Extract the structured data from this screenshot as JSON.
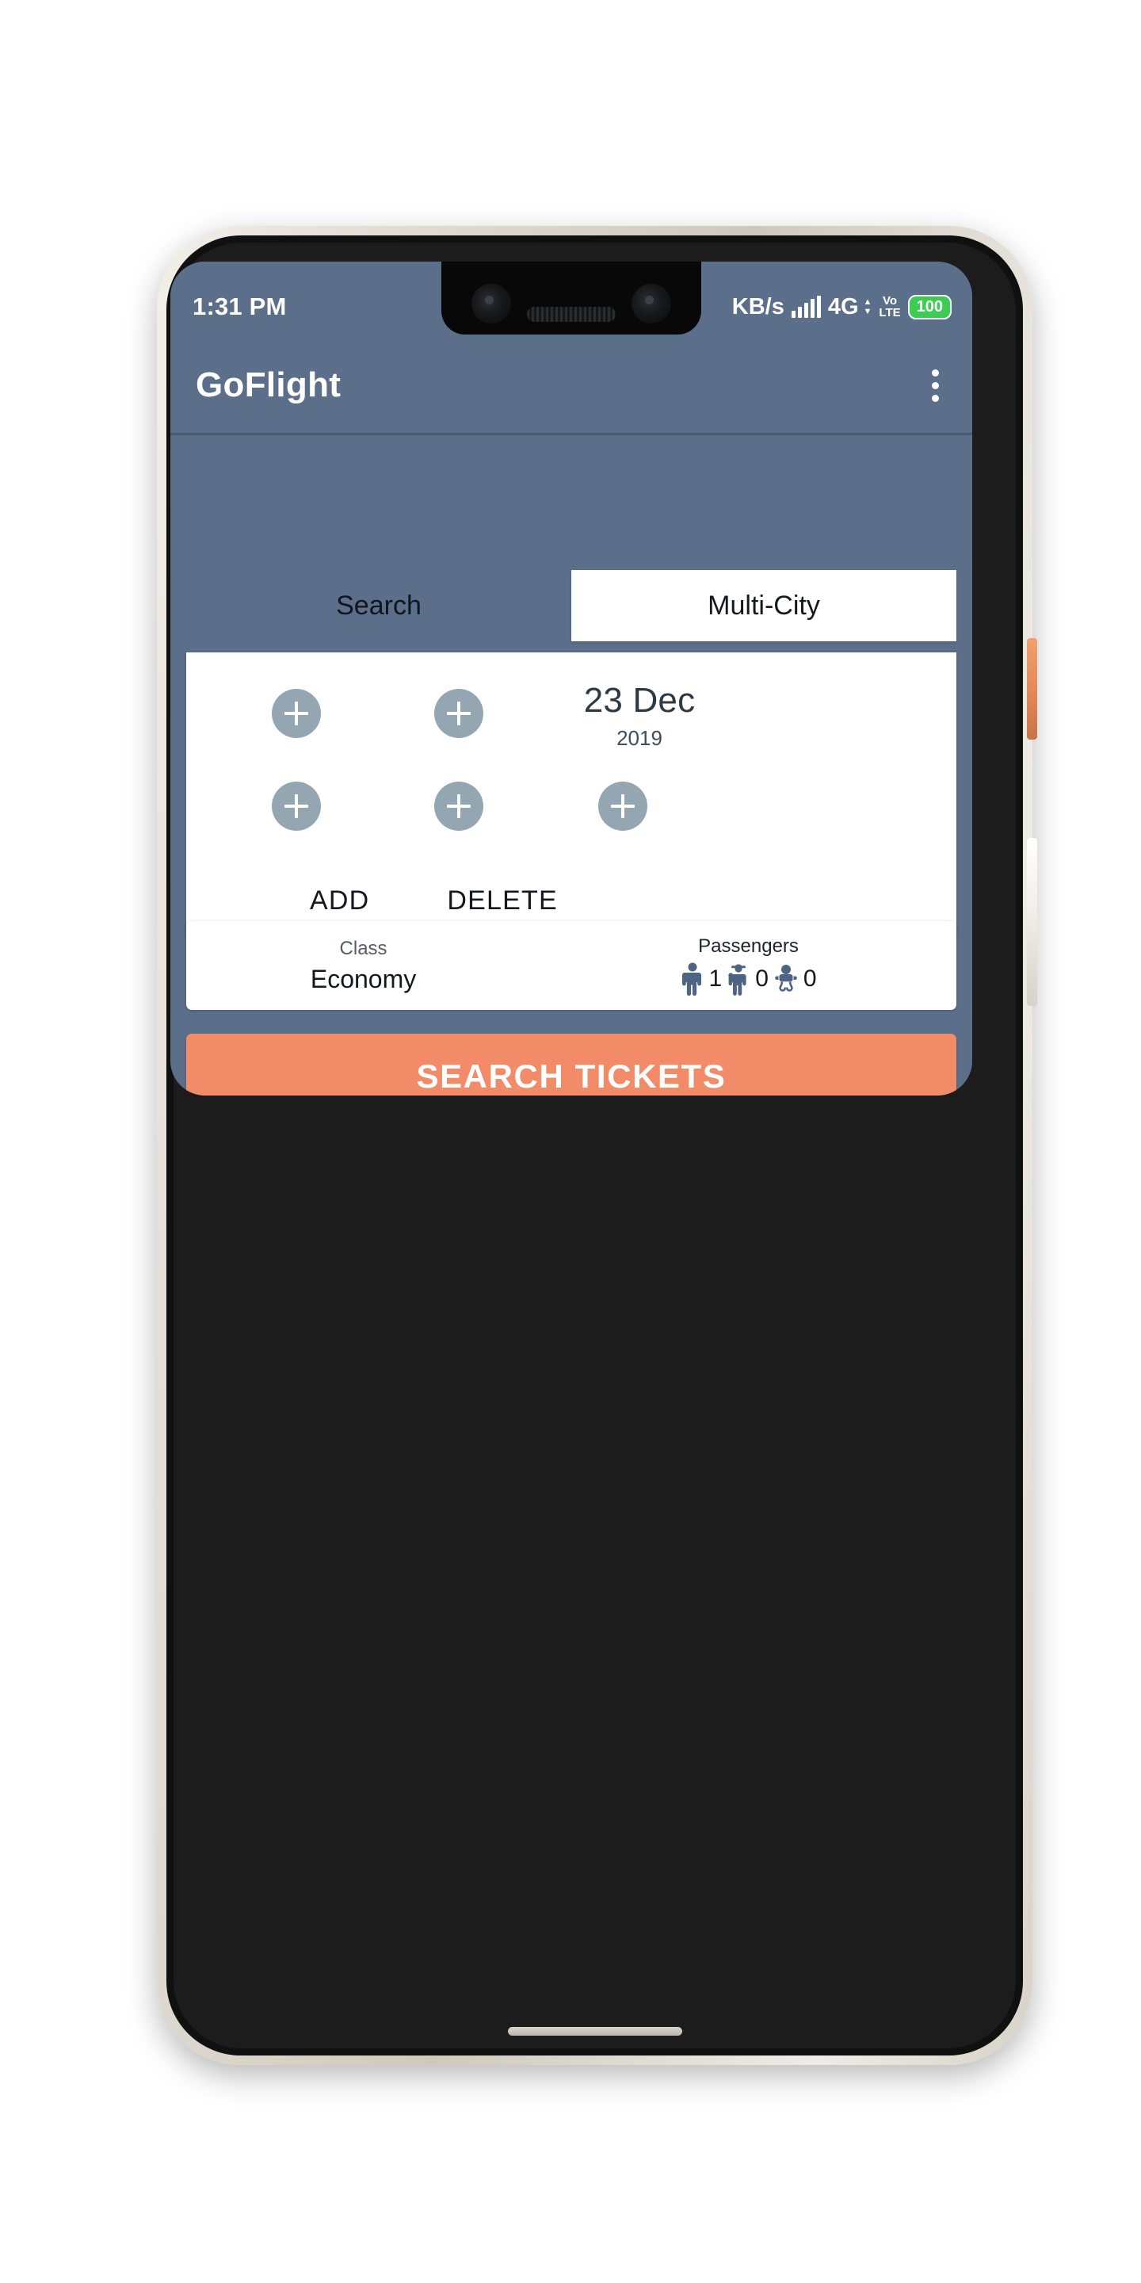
{
  "status_bar": {
    "time": "1:31 PM",
    "data_rate": "KB/s",
    "network": "4G",
    "volte_top": "Vo",
    "volte_bottom": "LTE",
    "battery": "100"
  },
  "app_bar": {
    "title": "GoFlight",
    "overflow_icon": "more-vertical-icon"
  },
  "tabs": [
    {
      "label": "Search",
      "active": false
    },
    {
      "label": "Multi-City",
      "active": true
    }
  ],
  "trip_card": {
    "add_buttons": [
      {
        "name": "add-origin-1",
        "icon": "plus-icon"
      },
      {
        "name": "add-destination-1",
        "icon": "plus-icon"
      },
      {
        "name": "add-origin-2",
        "icon": "plus-icon"
      },
      {
        "name": "add-destination-2",
        "icon": "plus-icon"
      },
      {
        "name": "add-date-2",
        "icon": "plus-icon"
      }
    ],
    "date": {
      "day_month": "23 Dec",
      "year": "2019"
    },
    "add_label": "ADD",
    "delete_label": "DELETE"
  },
  "class_passengers": {
    "class_label": "Class",
    "class_value": "Economy",
    "passengers_label": "Passengers",
    "adults": {
      "icon": "adult-icon",
      "count": "1"
    },
    "children": {
      "icon": "child-icon",
      "count": "0"
    },
    "infants": {
      "icon": "infant-icon",
      "count": "0"
    }
  },
  "search_button": {
    "label": "SEARCH TICKETS"
  },
  "nav_bar": {
    "recents_icon": "square-recents-icon",
    "home_icon": "circle-home-icon",
    "back_icon": "triangle-back-icon"
  },
  "colors": {
    "background": "#5c6f8a",
    "accent": "#f18b68",
    "card": "#ffffff",
    "plus_circle": "#93a6b1",
    "battery_green": "#3ccc52",
    "date_text": "#2c3a45"
  }
}
